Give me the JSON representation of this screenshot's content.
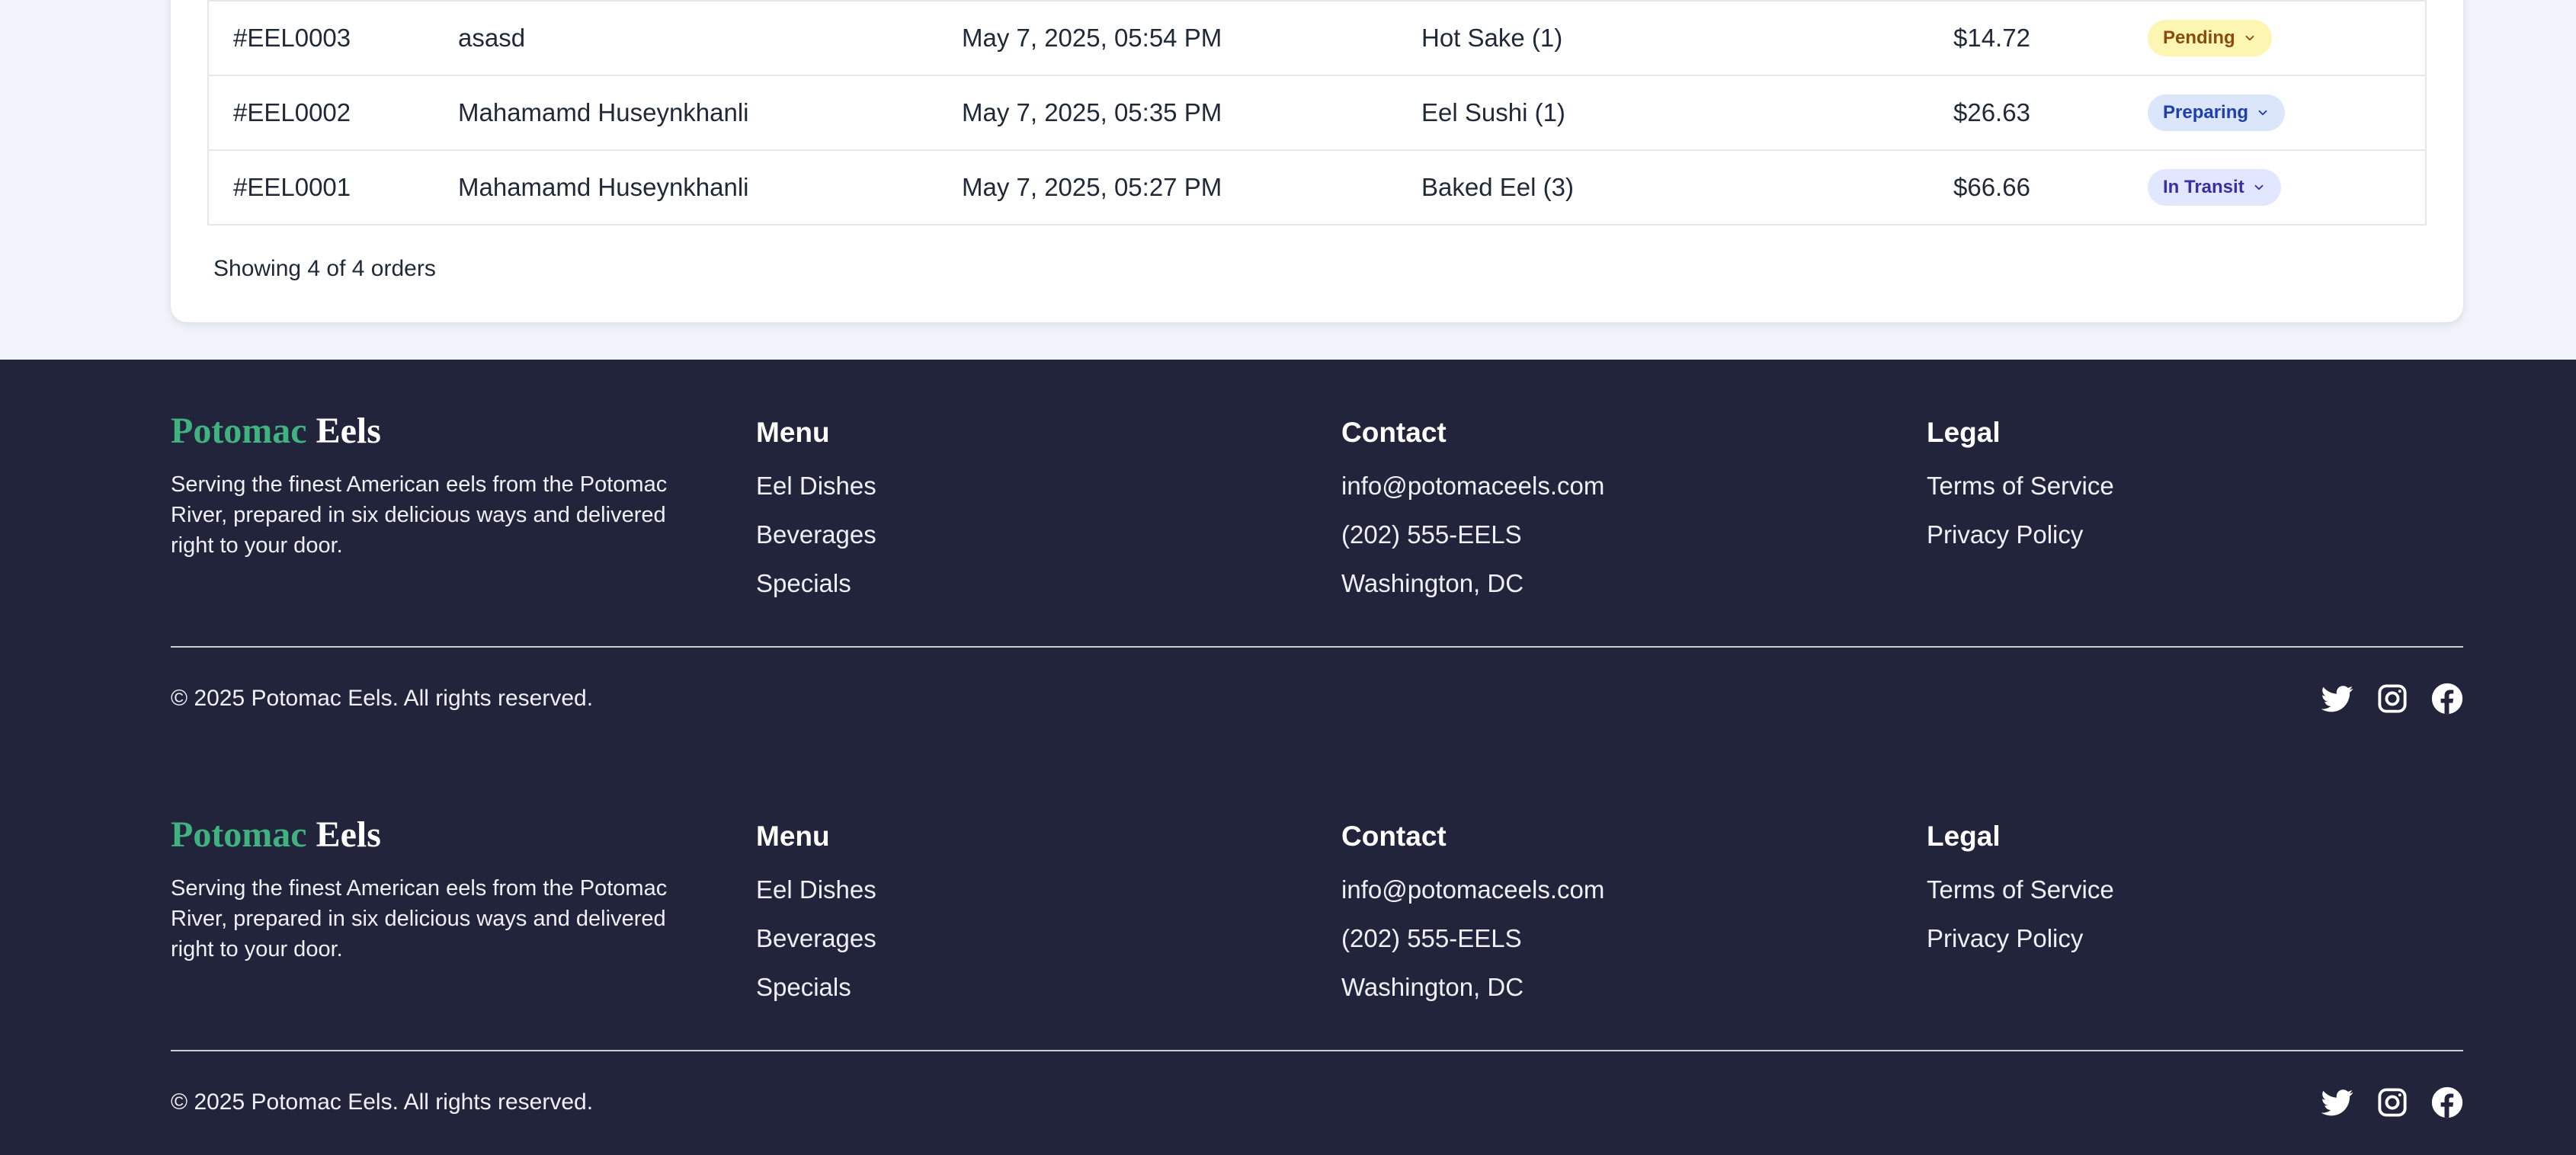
{
  "orders": {
    "rows": [
      {
        "id": "#EEL0003",
        "customer": "asasd",
        "date": "May 7, 2025, 05:54 PM",
        "items": "Hot Sake (1)",
        "total": "$14.72",
        "status": "Pending"
      },
      {
        "id": "#EEL0002",
        "customer": "Mahamamd Huseynkhanli",
        "date": "May 7, 2025, 05:35 PM",
        "items": "Eel Sushi (1)",
        "total": "$26.63",
        "status": "Preparing"
      },
      {
        "id": "#EEL0001",
        "customer": "Mahamamd Huseynkhanli",
        "date": "May 7, 2025, 05:27 PM",
        "items": "Baked Eel (3)",
        "total": "$66.66",
        "status": "In Transit"
      }
    ],
    "showing": "Showing 4 of 4 orders"
  },
  "status_colors": {
    "Pending": {
      "bg": "#fdf6b2",
      "fg": "#8a4b0f"
    },
    "Preparing": {
      "bg": "#dbe6fb",
      "fg": "#1e40af"
    },
    "In Transit": {
      "bg": "#e0e7ff",
      "fg": "#3730a3"
    }
  },
  "footer": {
    "brand_green": "Potomac",
    "brand_white": "Eels",
    "brand_color": "#3fb27f",
    "tagline": "Serving the finest American eels from the Potomac River, prepared in six delicious ways and delivered right to your door.",
    "menu": {
      "title": "Menu",
      "links": [
        "Eel Dishes",
        "Beverages",
        "Specials"
      ]
    },
    "contact": {
      "title": "Contact",
      "lines": [
        "info@potomaceels.com",
        "(202) 555-EELS",
        "Washington, DC"
      ]
    },
    "legal": {
      "title": "Legal",
      "links": [
        "Terms of Service",
        "Privacy Policy"
      ]
    },
    "copyright": "© 2025 Potomac Eels. All rights reserved.",
    "social_icons": [
      "twitter-icon",
      "instagram-icon",
      "facebook-icon"
    ]
  }
}
